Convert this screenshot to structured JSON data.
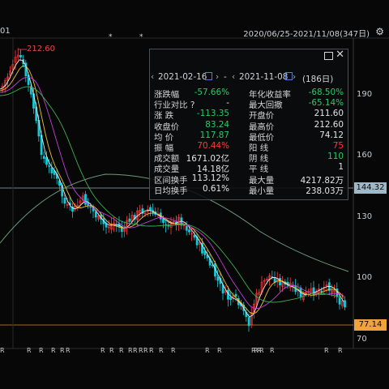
{
  "header": {
    "left_clip": "01",
    "range": "2020/06/25-2021/11/08(347日)",
    "settings_icon": "gear-icon"
  },
  "chart": {
    "high_marker": "212.60",
    "price_ticks": [
      "190",
      "160",
      "130",
      "100",
      "70"
    ],
    "current_price_tag": "144.32",
    "low_price_tag": "77.14",
    "tag_colors": {
      "current": "#9fb8c8",
      "low": "#f0a23c"
    },
    "stars": [
      "*",
      "*"
    ],
    "r_marks": [
      "R",
      "R",
      "R",
      "R",
      "R",
      "R",
      "R",
      "R",
      "R",
      "R",
      "R",
      "R",
      "R",
      "R",
      "R",
      "R",
      "R",
      "R",
      "R",
      "R",
      "R",
      "R",
      "R",
      "R",
      "R"
    ]
  },
  "panel": {
    "start_date": "2021-02-16",
    "dash": "-",
    "end_date": "2021-11-08",
    "days": "(186日)",
    "rows": [
      {
        "l1": "涨跌幅",
        "v1": "-57.66%",
        "c1": "green",
        "l2": "年化收益率",
        "v2": "-68.50%",
        "c2": "green"
      },
      {
        "l1": "行业对比 ?",
        "v1": "-",
        "c1": "white",
        "l2": "最大回撤",
        "v2": "-65.14%",
        "c2": "green"
      },
      {
        "l1": "涨  跌",
        "v1": "-113.35",
        "c1": "green",
        "l2": "开盘价",
        "v2": "211.60",
        "c2": "white"
      },
      {
        "l1": "收盘价",
        "v1": "83.24",
        "c1": "green",
        "l2": "最高价",
        "v2": "212.60",
        "c2": "white"
      },
      {
        "l1": "均  价",
        "v1": "117.87",
        "c1": "green",
        "l2": "最低价",
        "v2": "74.12",
        "c2": "white"
      },
      {
        "l1": "振  幅",
        "v1": "70.44%",
        "c1": "red",
        "l2": "阳  线",
        "v2": "75",
        "c2": "red"
      },
      {
        "l1": "成交额",
        "v1": "1671.02亿",
        "c1": "white",
        "l2": "阴  线",
        "v2": "110",
        "c2": "green"
      },
      {
        "l1": "成交量",
        "v1": "14.18亿",
        "c1": "white",
        "l2": "平  线",
        "v2": "1",
        "c2": "white"
      },
      {
        "l1": "区间换手",
        "v1": "113.12%",
        "c1": "white",
        "l2": "最大量",
        "v2": "4217.82万",
        "c2": "white"
      },
      {
        "l1": "日均换手",
        "v1": "0.61%",
        "c1": "white",
        "l2": "最小量",
        "v2": "238.03万",
        "c2": "white"
      }
    ]
  }
}
